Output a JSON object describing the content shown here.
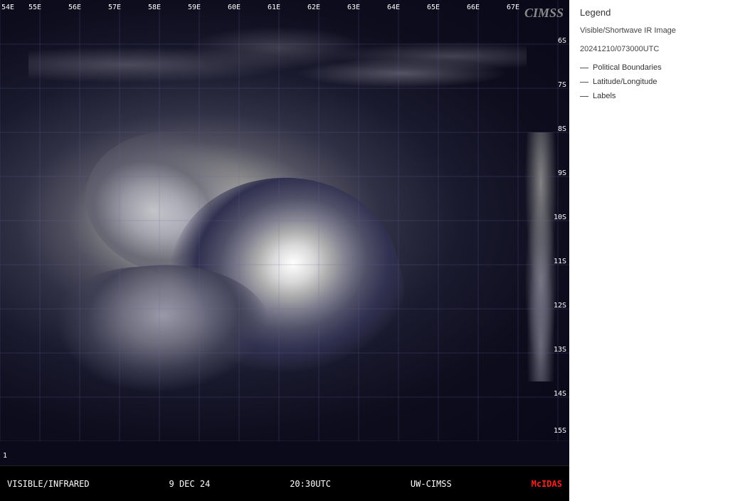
{
  "map": {
    "longitude_labels": [
      "54E",
      "55E",
      "56E",
      "57E",
      "58E",
      "59E",
      "60E",
      "61E",
      "62E",
      "63E",
      "64E",
      "65E",
      "66E",
      "67E"
    ],
    "latitude_labels": [
      "6S",
      "7S",
      "8S",
      "9S",
      "10S",
      "11S",
      "12S",
      "13S",
      "14S",
      "15S"
    ],
    "cimss_watermark": "CIMSS",
    "number_badge": "1"
  },
  "status_bar": {
    "mode": "VISIBLE/INFRARED",
    "date": "9 DEC 24",
    "time": "20:30UTC",
    "source": "UW-CIMSS",
    "software": "McIDAS"
  },
  "legend": {
    "title": "Legend",
    "image_label": "Visible/Shortwave IR Image",
    "timestamp": "20241210/073000UTC",
    "items": [
      {
        "label": "Political Boundaries"
      },
      {
        "label": "Latitude/Longitude"
      },
      {
        "label": "Labels"
      }
    ]
  }
}
